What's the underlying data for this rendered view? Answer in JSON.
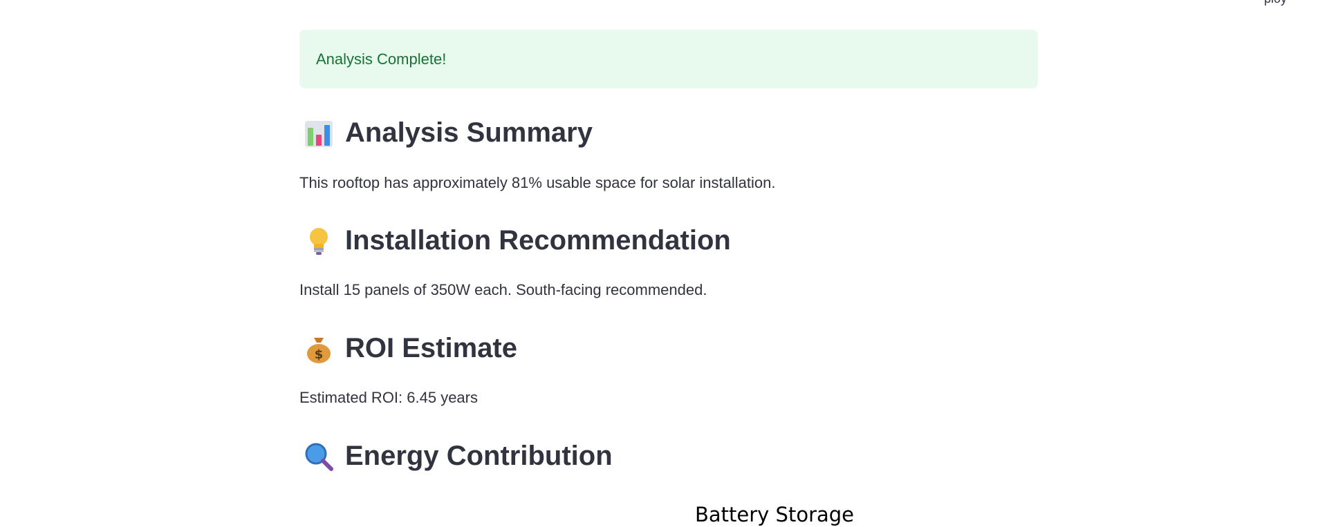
{
  "toolbar_partial": {
    "text": "ploy"
  },
  "alert": {
    "text": "Analysis Complete!"
  },
  "sections": [
    {
      "icon": "bar-chart-icon",
      "title": "Analysis Summary",
      "text": "This rooftop has approximately 81% usable space for solar installation."
    },
    {
      "icon": "light-bulb-icon",
      "title": "Installation Recommendation",
      "text": "Install 15 panels of 350W each. South-facing recommended."
    },
    {
      "icon": "money-bag-icon",
      "title": "ROI Estimate",
      "text": "Estimated ROI: 6.45 years"
    },
    {
      "icon": "magnifier-icon",
      "title": "Energy Contribution",
      "text": ""
    }
  ],
  "chart": {
    "title": "Battery Storage"
  }
}
